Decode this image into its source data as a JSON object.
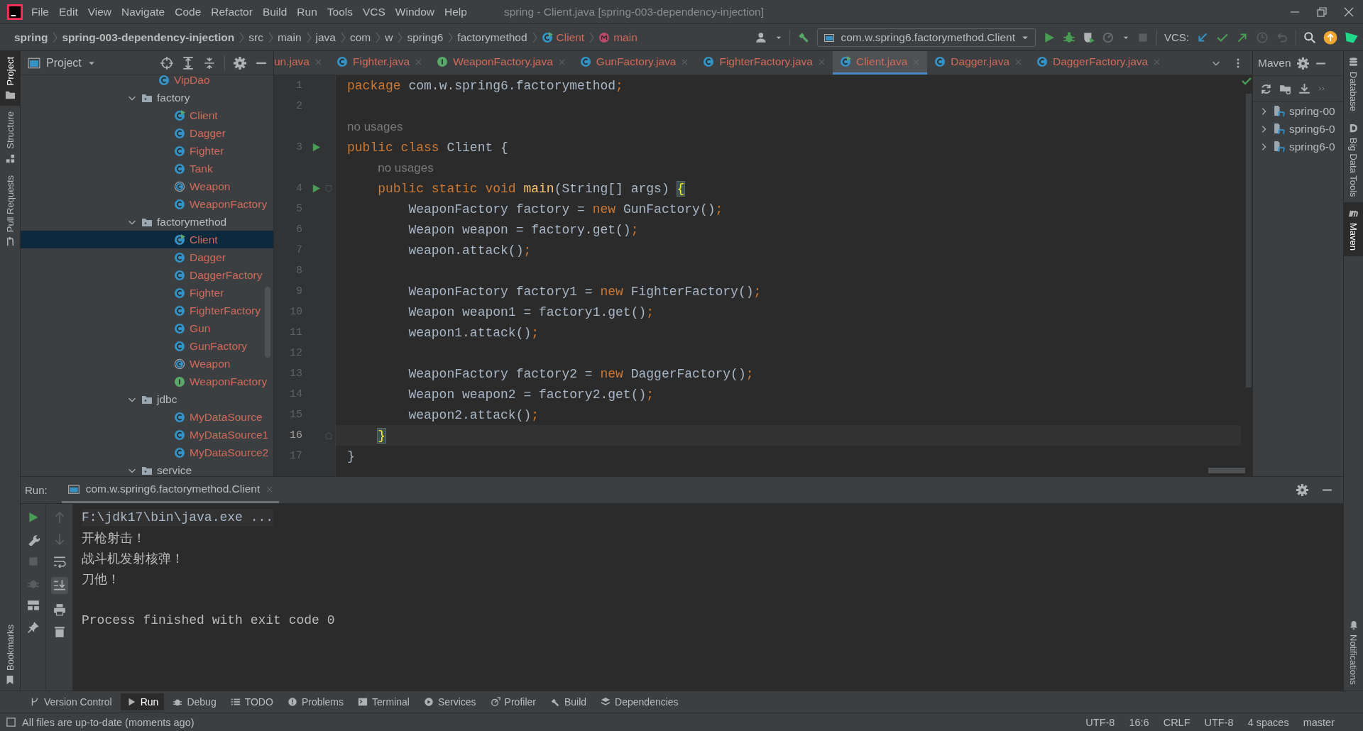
{
  "window": {
    "title": "spring - Client.java [spring-003-dependency-injection]"
  },
  "menu": [
    "File",
    "Edit",
    "View",
    "Navigate",
    "Code",
    "Refactor",
    "Build",
    "Run",
    "Tools",
    "VCS",
    "Window",
    "Help"
  ],
  "breadcrumbs": [
    {
      "label": "spring",
      "kind": "project"
    },
    {
      "label": "spring-003-dependency-injection",
      "kind": "project"
    },
    {
      "label": "src",
      "kind": "dir"
    },
    {
      "label": "main",
      "kind": "dir"
    },
    {
      "label": "java",
      "kind": "dir"
    },
    {
      "label": "com",
      "kind": "dir"
    },
    {
      "label": "w",
      "kind": "dir"
    },
    {
      "label": "spring6",
      "kind": "dir"
    },
    {
      "label": "factorymethod",
      "kind": "dir"
    },
    {
      "label": "Client",
      "kind": "class"
    },
    {
      "label": "main",
      "kind": "method"
    }
  ],
  "toolbar": {
    "run_config": "com.w.spring6.factorymethod.Client",
    "vcs_label": "VCS:"
  },
  "left_stripe": [
    {
      "label": "Project",
      "selected": true
    },
    {
      "label": "Structure",
      "selected": false
    },
    {
      "label": "Pull Requests",
      "selected": false
    }
  ],
  "left_stripe_bottom": {
    "label": "Bookmarks"
  },
  "project_panel": {
    "title": "Project",
    "tree": [
      {
        "label": "VipDao",
        "kind": "class",
        "selected": false
      },
      {
        "label": "factory",
        "kind": "folder",
        "expanded": true,
        "selected": false,
        "children": [
          {
            "label": "Client",
            "kind": "class-run",
            "selected": false
          },
          {
            "label": "Dagger",
            "kind": "class",
            "selected": false
          },
          {
            "label": "Fighter",
            "kind": "class",
            "selected": false
          },
          {
            "label": "Tank",
            "kind": "class",
            "selected": false
          },
          {
            "label": "Weapon",
            "kind": "abstract",
            "selected": false
          },
          {
            "label": "WeaponFactory",
            "kind": "class",
            "selected": false
          }
        ]
      },
      {
        "label": "factorymethod",
        "kind": "folder",
        "expanded": true,
        "selected": false,
        "children": [
          {
            "label": "Client",
            "kind": "class-run",
            "selected": true
          },
          {
            "label": "Dagger",
            "kind": "class",
            "selected": false
          },
          {
            "label": "DaggerFactory",
            "kind": "class",
            "selected": false
          },
          {
            "label": "Fighter",
            "kind": "class",
            "selected": false
          },
          {
            "label": "FighterFactory",
            "kind": "class",
            "selected": false
          },
          {
            "label": "Gun",
            "kind": "class",
            "selected": false
          },
          {
            "label": "GunFactory",
            "kind": "class",
            "selected": false
          },
          {
            "label": "Weapon",
            "kind": "abstract",
            "selected": false
          },
          {
            "label": "WeaponFactory",
            "kind": "interface",
            "selected": false
          }
        ]
      },
      {
        "label": "jdbc",
        "kind": "folder",
        "expanded": true,
        "selected": false,
        "children": [
          {
            "label": "MyDataSource",
            "kind": "class",
            "selected": false
          },
          {
            "label": "MyDataSource1",
            "kind": "class",
            "selected": false
          },
          {
            "label": "MyDataSource2",
            "kind": "class",
            "selected": false
          }
        ]
      },
      {
        "label": "service",
        "kind": "folder",
        "expanded": true,
        "selected": false
      }
    ]
  },
  "editor_tabs": [
    {
      "label": "un.java",
      "selected": false
    },
    {
      "label": "Fighter.java",
      "kind": "class",
      "selected": false
    },
    {
      "label": "WeaponFactory.java",
      "kind": "interface",
      "selected": false
    },
    {
      "label": "GunFactory.java",
      "kind": "class",
      "selected": false
    },
    {
      "label": "FighterFactory.java",
      "kind": "class",
      "selected": false
    },
    {
      "label": "Client.java",
      "kind": "class-run",
      "selected": true
    },
    {
      "label": "Dagger.java",
      "kind": "class",
      "selected": false
    },
    {
      "label": "DaggerFactory.java",
      "kind": "class",
      "selected": false
    }
  ],
  "editor": {
    "lines": [
      {
        "number": "1",
        "current": false,
        "tokens": [
          {
            "kind": "kw",
            "t": "package "
          },
          {
            "kind": "plain",
            "t": "com.w.spring6.factorymethod"
          },
          {
            "kind": "kw",
            "t": ";"
          }
        ]
      },
      {
        "number": "2",
        "current": false
      },
      {
        "number": "3",
        "current": false,
        "hint": "no usages",
        "gutter": {
          "kind": "run"
        },
        "tokens": [
          {
            "kind": "kw",
            "t": "public class "
          },
          {
            "kind": "plain",
            "t": "Client {"
          }
        ]
      },
      {
        "number": "4",
        "current": false,
        "hint": "no usages",
        "gutter": {
          "kind": "run"
        },
        "fold": {
          "kind": "start"
        },
        "tokens": [
          {
            "kind": "kw",
            "t": "    public static void "
          },
          {
            "kind": "fn",
            "t": "main"
          },
          {
            "kind": "plain",
            "t": "(String[] args) "
          },
          {
            "kind": "match",
            "t": "{"
          }
        ]
      },
      {
        "number": "5",
        "current": false,
        "tokens": [
          {
            "kind": "plain",
            "t": "        WeaponFactory factory = "
          },
          {
            "kind": "kw",
            "t": "new "
          },
          {
            "kind": "plain",
            "t": "GunFactory()"
          },
          {
            "kind": "kw",
            "t": ";"
          }
        ]
      },
      {
        "number": "6",
        "current": false,
        "tokens": [
          {
            "kind": "plain",
            "t": "        Weapon weapon = factory.get()"
          },
          {
            "kind": "kw",
            "t": ";"
          }
        ]
      },
      {
        "number": "7",
        "current": false,
        "tokens": [
          {
            "kind": "plain",
            "t": "        weapon.attack()"
          },
          {
            "kind": "kw",
            "t": ";"
          }
        ]
      },
      {
        "number": "8",
        "current": false
      },
      {
        "number": "9",
        "current": false,
        "tokens": [
          {
            "kind": "plain",
            "t": "        WeaponFactory factory1 = "
          },
          {
            "kind": "kw",
            "t": "new "
          },
          {
            "kind": "plain",
            "t": "FighterFactory()"
          },
          {
            "kind": "kw",
            "t": ";"
          }
        ]
      },
      {
        "number": "10",
        "current": false,
        "tokens": [
          {
            "kind": "plain",
            "t": "        Weapon weapon1 = factory1.get()"
          },
          {
            "kind": "kw",
            "t": ";"
          }
        ]
      },
      {
        "number": "11",
        "current": false,
        "tokens": [
          {
            "kind": "plain",
            "t": "        weapon1.attack()"
          },
          {
            "kind": "kw",
            "t": ";"
          }
        ]
      },
      {
        "number": "12",
        "current": false
      },
      {
        "number": "13",
        "current": false,
        "tokens": [
          {
            "kind": "plain",
            "t": "        WeaponFactory factory2 = "
          },
          {
            "kind": "kw",
            "t": "new "
          },
          {
            "kind": "plain",
            "t": "DaggerFactory()"
          },
          {
            "kind": "kw",
            "t": ";"
          }
        ]
      },
      {
        "number": "14",
        "current": false,
        "tokens": [
          {
            "kind": "plain",
            "t": "        Weapon weapon2 = factory2.get()"
          },
          {
            "kind": "kw",
            "t": ";"
          }
        ]
      },
      {
        "number": "15",
        "current": false,
        "tokens": [
          {
            "kind": "plain",
            "t": "        weapon2.attack()"
          },
          {
            "kind": "kw",
            "t": ";"
          }
        ]
      },
      {
        "number": "16",
        "current": true,
        "fold": {
          "kind": "end"
        },
        "tokens": [
          {
            "kind": "match",
            "t": "    }"
          }
        ]
      },
      {
        "number": "17",
        "current": false,
        "tokens": [
          {
            "kind": "plain",
            "t": "}"
          }
        ]
      }
    ]
  },
  "maven": {
    "title": "Maven",
    "projects": [
      {
        "label": "spring-00"
      },
      {
        "label": "spring6-0"
      },
      {
        "label": "spring6-0"
      }
    ]
  },
  "right_stripe": [
    {
      "label": "Database",
      "selected": false
    },
    {
      "label": "Big Data Tools",
      "selected": false
    },
    {
      "label": "Maven",
      "selected": true
    }
  ],
  "right_stripe_bottom": {
    "label": "Notifications"
  },
  "run_panel": {
    "label": "Run:",
    "tab": "com.w.spring6.factorymethod.Client",
    "output": [
      {
        "kind": "command",
        "text": "F:\\jdk17\\bin\\java.exe ..."
      },
      {
        "kind": "stdout",
        "text": "开枪射击！"
      },
      {
        "kind": "stdout",
        "text": "战斗机发射核弹！"
      },
      {
        "kind": "stdout",
        "text": "刀他！"
      },
      {
        "kind": "blank"
      },
      {
        "kind": "stdout",
        "text": "Process finished with exit code 0"
      }
    ]
  },
  "bottom_tools": [
    {
      "label": "Version Control",
      "selected": false
    },
    {
      "label": "Run",
      "selected": true
    },
    {
      "label": "Debug",
      "selected": false
    },
    {
      "label": "TODO",
      "selected": false
    },
    {
      "label": "Problems",
      "selected": false
    },
    {
      "label": "Terminal",
      "selected": false
    },
    {
      "label": "Services",
      "selected": false
    },
    {
      "label": "Profiler",
      "selected": false
    },
    {
      "label": "Build",
      "selected": false
    },
    {
      "label": "Dependencies",
      "selected": false
    }
  ],
  "status_bar": {
    "message": "All files are up-to-date (moments ago)",
    "items": [
      "UTF-8",
      "16:6",
      "CRLF",
      "UTF-8",
      "4 spaces",
      "master"
    ]
  }
}
